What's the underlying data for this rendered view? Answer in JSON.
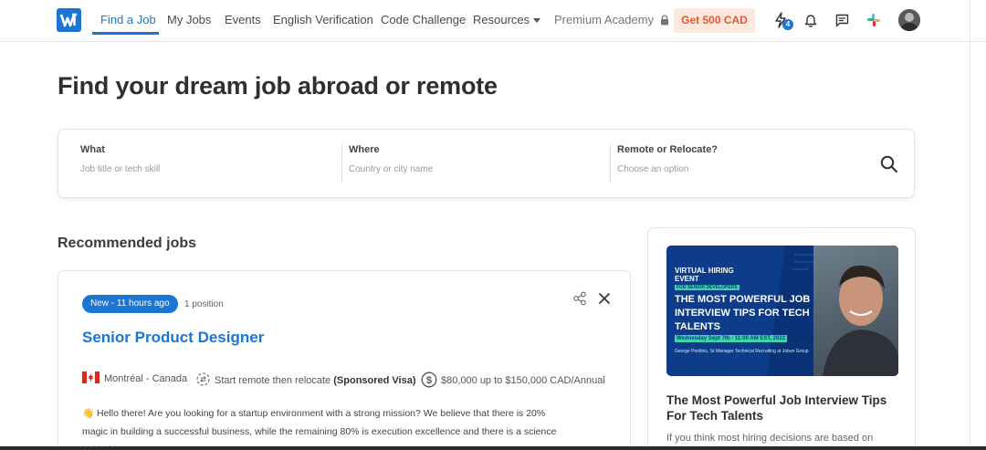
{
  "nav": {
    "logo_icon": "brand-logo",
    "items": [
      {
        "label": "Find a Job",
        "active": true
      },
      {
        "label": "My Jobs"
      },
      {
        "label": "Events"
      },
      {
        "label": "English Verification"
      },
      {
        "label": "Code Challenge"
      },
      {
        "label": "Resources"
      },
      {
        "label": "Premium Academy"
      }
    ],
    "cta_label": "Get 500 CAD",
    "notification_count": "4",
    "accent_color": "#1a76d2",
    "cta_color": "#e3582b"
  },
  "page": {
    "title": "Find your dream job abroad or remote"
  },
  "search": {
    "what_label": "What",
    "what_placeholder": "Job title or tech skill",
    "where_label": "Where",
    "where_placeholder": "Country or city name",
    "relocate_label": "Remote or Relocate?",
    "relocate_placeholder": "Choose an option"
  },
  "recommended": {
    "title": "Recommended jobs",
    "job": {
      "badge": "New - 11 hours ago",
      "positions": "1 position",
      "title": "Senior Product Designer",
      "location": "Montréal - Canada",
      "relocation_prefix": "Start remote then relocate",
      "relocation_visa": "(Sponsored Visa)",
      "salary": "$80,000 up to $150,000 CAD/Annual",
      "description": "👋 Hello there! Are you looking for a startup environment with a strong mission? We believe that there is 20% magic in building a successful business, while the remaining 80% is execution excellence and there is a science behind it."
    }
  },
  "sidebar": {
    "promo": {
      "event_type": "VIRTUAL HIRING EVENT",
      "event_sub": "FOR SENIOR DEVELOPERS",
      "headline": "THE MOST POWERFUL JOB INTERVIEW TIPS FOR TECH TALENTS",
      "date": "Wednesday Sept 7th - 11:00 AM EST, 2022",
      "speaker": "George Poofinis, Sr Manager Technical Recruiting at Jobun Group"
    },
    "title": "The Most Powerful Job Interview Tips For Tech Talents",
    "description": "If you think most hiring decisions are based on"
  }
}
